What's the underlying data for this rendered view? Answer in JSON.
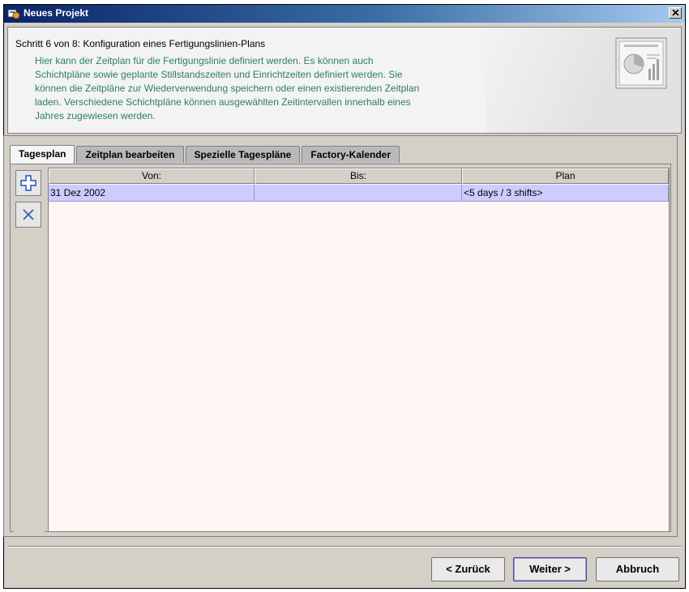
{
  "window": {
    "title": "Neues Projekt"
  },
  "header": {
    "step": "Schritt 6 von 8: Konfiguration eines Fertigungslinien-Plans",
    "description_lines": [
      "Hier kann der Zeitplan für die Fertigungslinie definiert werden. Es können auch",
      "Schichtpläne sowie geplante Stillstandszeiten und Einrichtzeiten definiert werden. Sie",
      "können die Zeitpläne zur Wiederverwendung speichern oder einen existierenden Zeitplan",
      "laden. Verschiedene Schichtpläne können ausgewählten Zeitintervallen innerhalb eines",
      "Jahres zugewiesen werden."
    ]
  },
  "tabs": [
    {
      "label": "Tagesplan",
      "active": true
    },
    {
      "label": "Zeitplan bearbeiten",
      "active": false
    },
    {
      "label": "Spezielle Tagespläne",
      "active": false
    },
    {
      "label": "Factory-Kalender",
      "active": false
    }
  ],
  "toolbar": {
    "icons": [
      "plus-icon",
      "x-icon"
    ]
  },
  "table": {
    "columns": [
      "Von:",
      "Bis:",
      "Plan"
    ],
    "rows": [
      {
        "von": "31 Dez 2002",
        "bis": "",
        "plan": "<5 days / 3 shifts>"
      }
    ]
  },
  "buttons": {
    "back": "< Zurück",
    "next": "Weiter >",
    "cancel": "Abbruch"
  },
  "colors": {
    "title_bar": "#0a246a",
    "description_text": "#2e7d6a",
    "selected_row": "#ccccff",
    "table_bg": "#fff5f5"
  }
}
